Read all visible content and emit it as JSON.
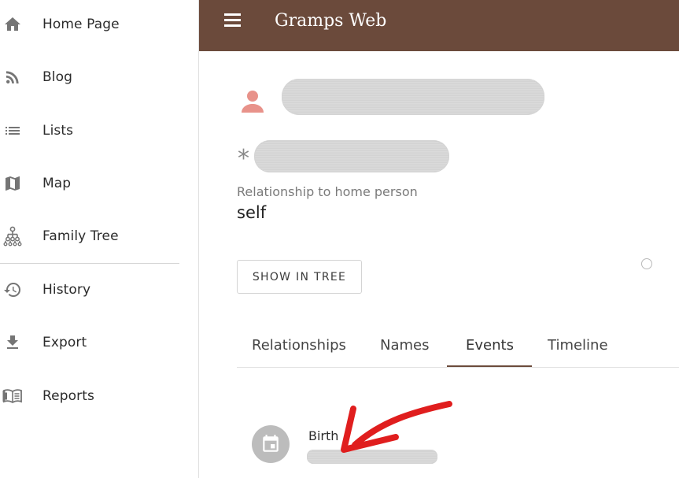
{
  "app": {
    "title": "Gramps Web"
  },
  "sidebar": {
    "items": [
      {
        "label": "Home Page",
        "icon": "home-icon"
      },
      {
        "label": "Blog",
        "icon": "rss-icon"
      },
      {
        "label": "Lists",
        "icon": "list-icon"
      },
      {
        "label": "Map",
        "icon": "map-icon"
      },
      {
        "label": "Family Tree",
        "icon": "family-tree-icon"
      },
      {
        "label": "History",
        "icon": "history-icon"
      },
      {
        "label": "Export",
        "icon": "download-icon"
      },
      {
        "label": "Reports",
        "icon": "book-icon"
      }
    ]
  },
  "person": {
    "relationship_label": "Relationship to home person",
    "relationship_value": "self",
    "birth_marker": "*",
    "show_in_tree_label": "SHOW IN TREE"
  },
  "tabs": [
    {
      "label": "Relationships"
    },
    {
      "label": "Names"
    },
    {
      "label": "Events",
      "active": true
    },
    {
      "label": "Timeline"
    }
  ],
  "events": [
    {
      "title": "Birth",
      "icon": "calendar-icon"
    }
  ],
  "colors": {
    "header": "#6b4a3b",
    "person_icon": "#e8928a",
    "annotation": "#e01e1e",
    "event_avatar": "#bcbcbc"
  }
}
